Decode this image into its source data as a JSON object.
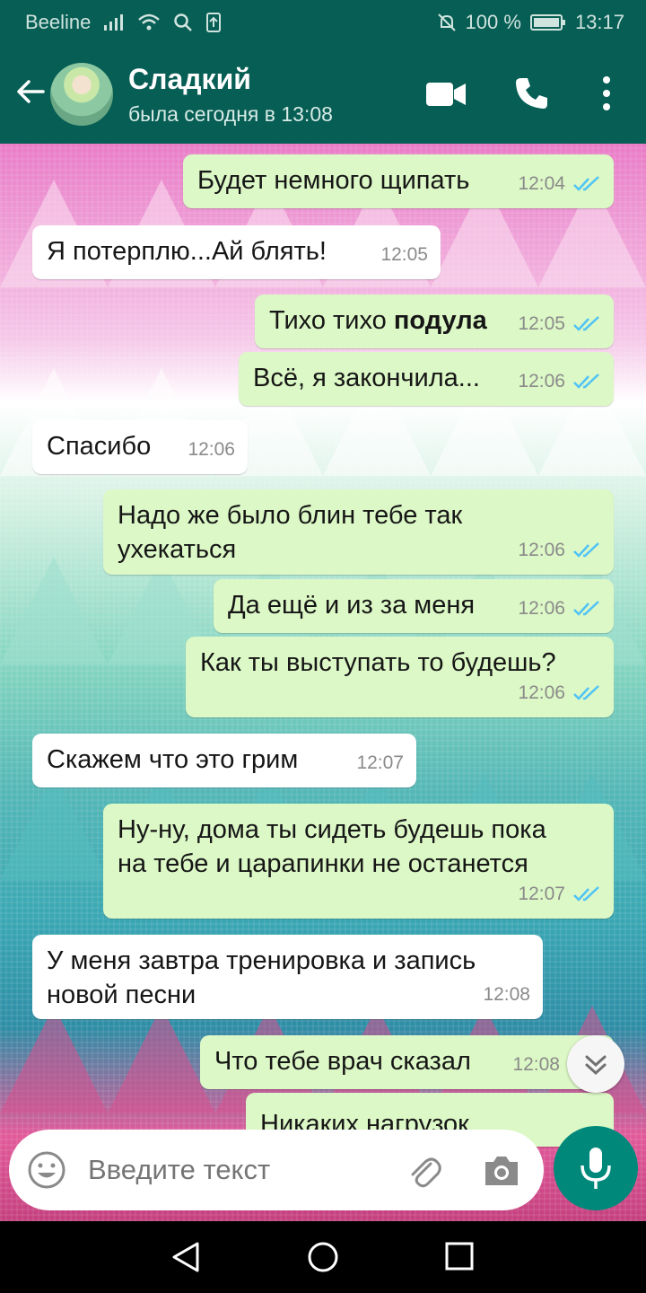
{
  "status_bar": {
    "carrier": "Beeline",
    "battery": "100 %",
    "time": "13:17"
  },
  "header": {
    "contact_name": "Сладкий",
    "last_seen": "была сегодня в 13:08"
  },
  "messages": [
    {
      "text": "Будет немного щипать",
      "time": "12:04"
    },
    {
      "text": "Я потерплю...Ай блять!",
      "time": "12:05"
    },
    {
      "text_before": "Тихо тихо ",
      "text_bold": "подула",
      "time": "12:05"
    },
    {
      "text": "Всё, я закончила...",
      "time": "12:06"
    },
    {
      "text": "Спасибо",
      "time": "12:06"
    },
    {
      "line1": "Надо же было блин тебе так",
      "line2": "ухекаться",
      "time": "12:06"
    },
    {
      "text": "Да ещё и из за меня",
      "time": "12:06"
    },
    {
      "text": "Как ты выступать то будешь?",
      "time": "12:06"
    },
    {
      "text": "Скажем что это грим",
      "time": "12:07"
    },
    {
      "line1": "Ну-ну, дома ты сидеть будешь пока",
      "line2": "на тебе и царапинки не останется",
      "time": "12:07"
    },
    {
      "line1": "У меня завтра тренировка и запись",
      "line2": "новой песни",
      "time": "12:08"
    },
    {
      "text": "Что тебе врач сказал",
      "time": "12:08"
    },
    {
      "text": "Никаких нагрузок"
    }
  ],
  "composer": {
    "placeholder": "Введите текст"
  },
  "colors": {
    "header": "#075e54",
    "outgoing_bubble": "#dcf8c6",
    "incoming_bubble": "#ffffff",
    "read_ticks": "#4fc3f7",
    "mic_button": "#00897b"
  }
}
